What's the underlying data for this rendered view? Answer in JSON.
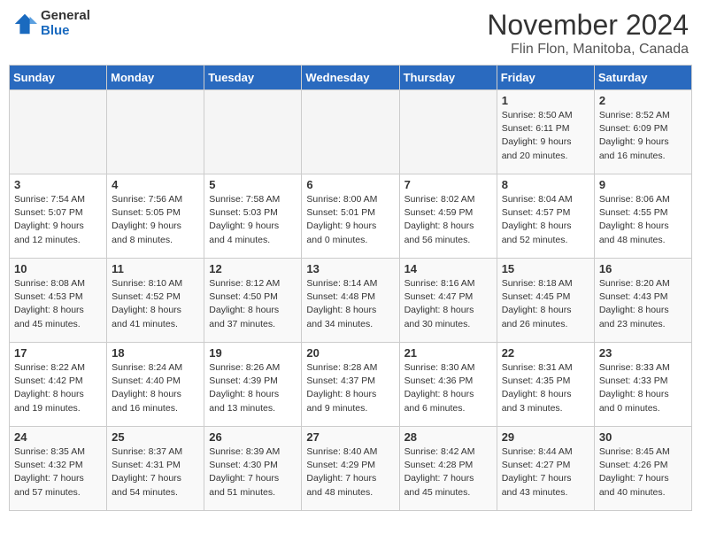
{
  "header": {
    "logo_general": "General",
    "logo_blue": "Blue",
    "month_title": "November 2024",
    "location": "Flin Flon, Manitoba, Canada"
  },
  "days_of_week": [
    "Sunday",
    "Monday",
    "Tuesday",
    "Wednesday",
    "Thursday",
    "Friday",
    "Saturday"
  ],
  "weeks": [
    [
      {
        "day": "",
        "info": ""
      },
      {
        "day": "",
        "info": ""
      },
      {
        "day": "",
        "info": ""
      },
      {
        "day": "",
        "info": ""
      },
      {
        "day": "",
        "info": ""
      },
      {
        "day": "1",
        "info": "Sunrise: 8:50 AM\nSunset: 6:11 PM\nDaylight: 9 hours and 20 minutes."
      },
      {
        "day": "2",
        "info": "Sunrise: 8:52 AM\nSunset: 6:09 PM\nDaylight: 9 hours and 16 minutes."
      }
    ],
    [
      {
        "day": "3",
        "info": "Sunrise: 7:54 AM\nSunset: 5:07 PM\nDaylight: 9 hours and 12 minutes."
      },
      {
        "day": "4",
        "info": "Sunrise: 7:56 AM\nSunset: 5:05 PM\nDaylight: 9 hours and 8 minutes."
      },
      {
        "day": "5",
        "info": "Sunrise: 7:58 AM\nSunset: 5:03 PM\nDaylight: 9 hours and 4 minutes."
      },
      {
        "day": "6",
        "info": "Sunrise: 8:00 AM\nSunset: 5:01 PM\nDaylight: 9 hours and 0 minutes."
      },
      {
        "day": "7",
        "info": "Sunrise: 8:02 AM\nSunset: 4:59 PM\nDaylight: 8 hours and 56 minutes."
      },
      {
        "day": "8",
        "info": "Sunrise: 8:04 AM\nSunset: 4:57 PM\nDaylight: 8 hours and 52 minutes."
      },
      {
        "day": "9",
        "info": "Sunrise: 8:06 AM\nSunset: 4:55 PM\nDaylight: 8 hours and 48 minutes."
      }
    ],
    [
      {
        "day": "10",
        "info": "Sunrise: 8:08 AM\nSunset: 4:53 PM\nDaylight: 8 hours and 45 minutes."
      },
      {
        "day": "11",
        "info": "Sunrise: 8:10 AM\nSunset: 4:52 PM\nDaylight: 8 hours and 41 minutes."
      },
      {
        "day": "12",
        "info": "Sunrise: 8:12 AM\nSunset: 4:50 PM\nDaylight: 8 hours and 37 minutes."
      },
      {
        "day": "13",
        "info": "Sunrise: 8:14 AM\nSunset: 4:48 PM\nDaylight: 8 hours and 34 minutes."
      },
      {
        "day": "14",
        "info": "Sunrise: 8:16 AM\nSunset: 4:47 PM\nDaylight: 8 hours and 30 minutes."
      },
      {
        "day": "15",
        "info": "Sunrise: 8:18 AM\nSunset: 4:45 PM\nDaylight: 8 hours and 26 minutes."
      },
      {
        "day": "16",
        "info": "Sunrise: 8:20 AM\nSunset: 4:43 PM\nDaylight: 8 hours and 23 minutes."
      }
    ],
    [
      {
        "day": "17",
        "info": "Sunrise: 8:22 AM\nSunset: 4:42 PM\nDaylight: 8 hours and 19 minutes."
      },
      {
        "day": "18",
        "info": "Sunrise: 8:24 AM\nSunset: 4:40 PM\nDaylight: 8 hours and 16 minutes."
      },
      {
        "day": "19",
        "info": "Sunrise: 8:26 AM\nSunset: 4:39 PM\nDaylight: 8 hours and 13 minutes."
      },
      {
        "day": "20",
        "info": "Sunrise: 8:28 AM\nSunset: 4:37 PM\nDaylight: 8 hours and 9 minutes."
      },
      {
        "day": "21",
        "info": "Sunrise: 8:30 AM\nSunset: 4:36 PM\nDaylight: 8 hours and 6 minutes."
      },
      {
        "day": "22",
        "info": "Sunrise: 8:31 AM\nSunset: 4:35 PM\nDaylight: 8 hours and 3 minutes."
      },
      {
        "day": "23",
        "info": "Sunrise: 8:33 AM\nSunset: 4:33 PM\nDaylight: 8 hours and 0 minutes."
      }
    ],
    [
      {
        "day": "24",
        "info": "Sunrise: 8:35 AM\nSunset: 4:32 PM\nDaylight: 7 hours and 57 minutes."
      },
      {
        "day": "25",
        "info": "Sunrise: 8:37 AM\nSunset: 4:31 PM\nDaylight: 7 hours and 54 minutes."
      },
      {
        "day": "26",
        "info": "Sunrise: 8:39 AM\nSunset: 4:30 PM\nDaylight: 7 hours and 51 minutes."
      },
      {
        "day": "27",
        "info": "Sunrise: 8:40 AM\nSunset: 4:29 PM\nDaylight: 7 hours and 48 minutes."
      },
      {
        "day": "28",
        "info": "Sunrise: 8:42 AM\nSunset: 4:28 PM\nDaylight: 7 hours and 45 minutes."
      },
      {
        "day": "29",
        "info": "Sunrise: 8:44 AM\nSunset: 4:27 PM\nDaylight: 7 hours and 43 minutes."
      },
      {
        "day": "30",
        "info": "Sunrise: 8:45 AM\nSunset: 4:26 PM\nDaylight: 7 hours and 40 minutes."
      }
    ]
  ]
}
